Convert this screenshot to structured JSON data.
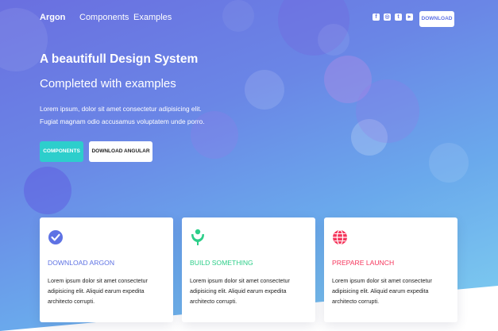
{
  "nav": {
    "brand": "Argon",
    "links": [
      "Components",
      "Examples"
    ],
    "social_icons": [
      "facebook-icon",
      "instagram-icon",
      "twitter-icon",
      "youtube-icon"
    ],
    "download_label": "DOWNLOAD"
  },
  "hero": {
    "title": "A beautifull Design System",
    "subtitle": "Completed with examples",
    "lead_line1": "Lorem ipsum, dolor sit amet consectetur adipisicing elit.",
    "lead_line2": "Fugiat magnam odio accusamus voluptatem unde porro.",
    "primary_button": "COMPONENTS",
    "secondary_button": "DOWNLOAD ANGULAR"
  },
  "cards": [
    {
      "title": "DOWNLOAD ARGON",
      "text": "Lorem ipsum dolor sit amet consectetur adipisicing elit. Aliquid earum expedita architecto corrupti.",
      "icon": "check-badge-icon",
      "color": "#5e72e4"
    },
    {
      "title": "BUILD SOMETHING",
      "text": "Lorem ipsum dolor sit amet consectetur adipisicing elit. Aliquid earum expedita architecto corrupti.",
      "icon": "people-icon",
      "color": "#2dce89"
    },
    {
      "title": "PREPARE LAUNCH",
      "text": "Lorem ipsum dolor sit amet consectetur adipisicing elit. Aliquid earum expedita architecto corrupti.",
      "icon": "globe-icon",
      "color": "#f5365c"
    }
  ],
  "colors": {
    "primary": "#5e72e4",
    "info": "#2dcecc",
    "success": "#2dce89",
    "danger": "#f5365c"
  }
}
